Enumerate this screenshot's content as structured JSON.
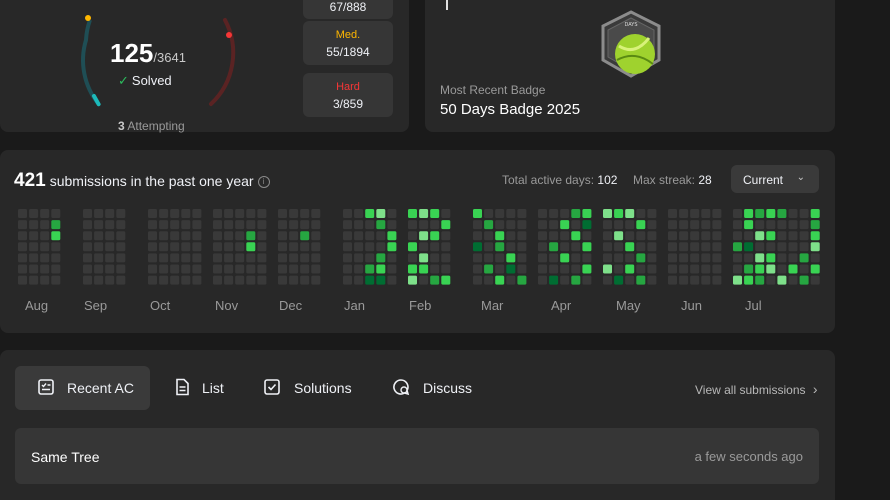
{
  "stats": {
    "solved": "125",
    "total": "/3641",
    "solved_label": "Solved",
    "check": "✓",
    "attempting_count": "3",
    "attempting_label": "Attempting",
    "easy": {
      "value": "67/888"
    },
    "medium": {
      "label": "Med.",
      "value": "55/1894",
      "color": "#ffb700"
    },
    "hard": {
      "label": "Hard",
      "value": "3/859",
      "color": "#f63636"
    }
  },
  "badge": {
    "caption": "Most Recent Badge",
    "name": "50 Days Badge 2025",
    "icon_text": "DAYS",
    "icon": "50-days-badge-icon"
  },
  "heatmap": {
    "count": "421",
    "title_rest": "submissions in the past one year",
    "info_icon": "i",
    "active_days_label": "Total active days:",
    "active_days": "102",
    "max_streak_label": "Max streak:",
    "max_streak": "28",
    "select_value": "Current",
    "select_chev": "⌄",
    "months": [
      "Aug",
      "Sep",
      "Oct",
      "Nov",
      "Dec",
      "Jan",
      "Feb",
      "Mar",
      "Apr",
      "May",
      "Jun",
      "Jul"
    ],
    "colors": {
      "empty": "#393939",
      "l1": "#0e4429",
      "l2": "#006d32",
      "l3": "#26a641",
      "l4": "#39d353",
      "l5": "#7ee08a"
    }
  },
  "recent": {
    "tabs": [
      {
        "label": "Recent AC",
        "icon": "recent-ac-icon"
      },
      {
        "label": "List",
        "icon": "list-icon"
      },
      {
        "label": "Solutions",
        "icon": "solutions-icon"
      },
      {
        "label": "Discuss",
        "icon": "discuss-icon"
      }
    ],
    "view_all": "View all submissions",
    "view_all_chev": "›",
    "rows": [
      {
        "title": "Same Tree",
        "time": "a few seconds ago"
      }
    ]
  }
}
